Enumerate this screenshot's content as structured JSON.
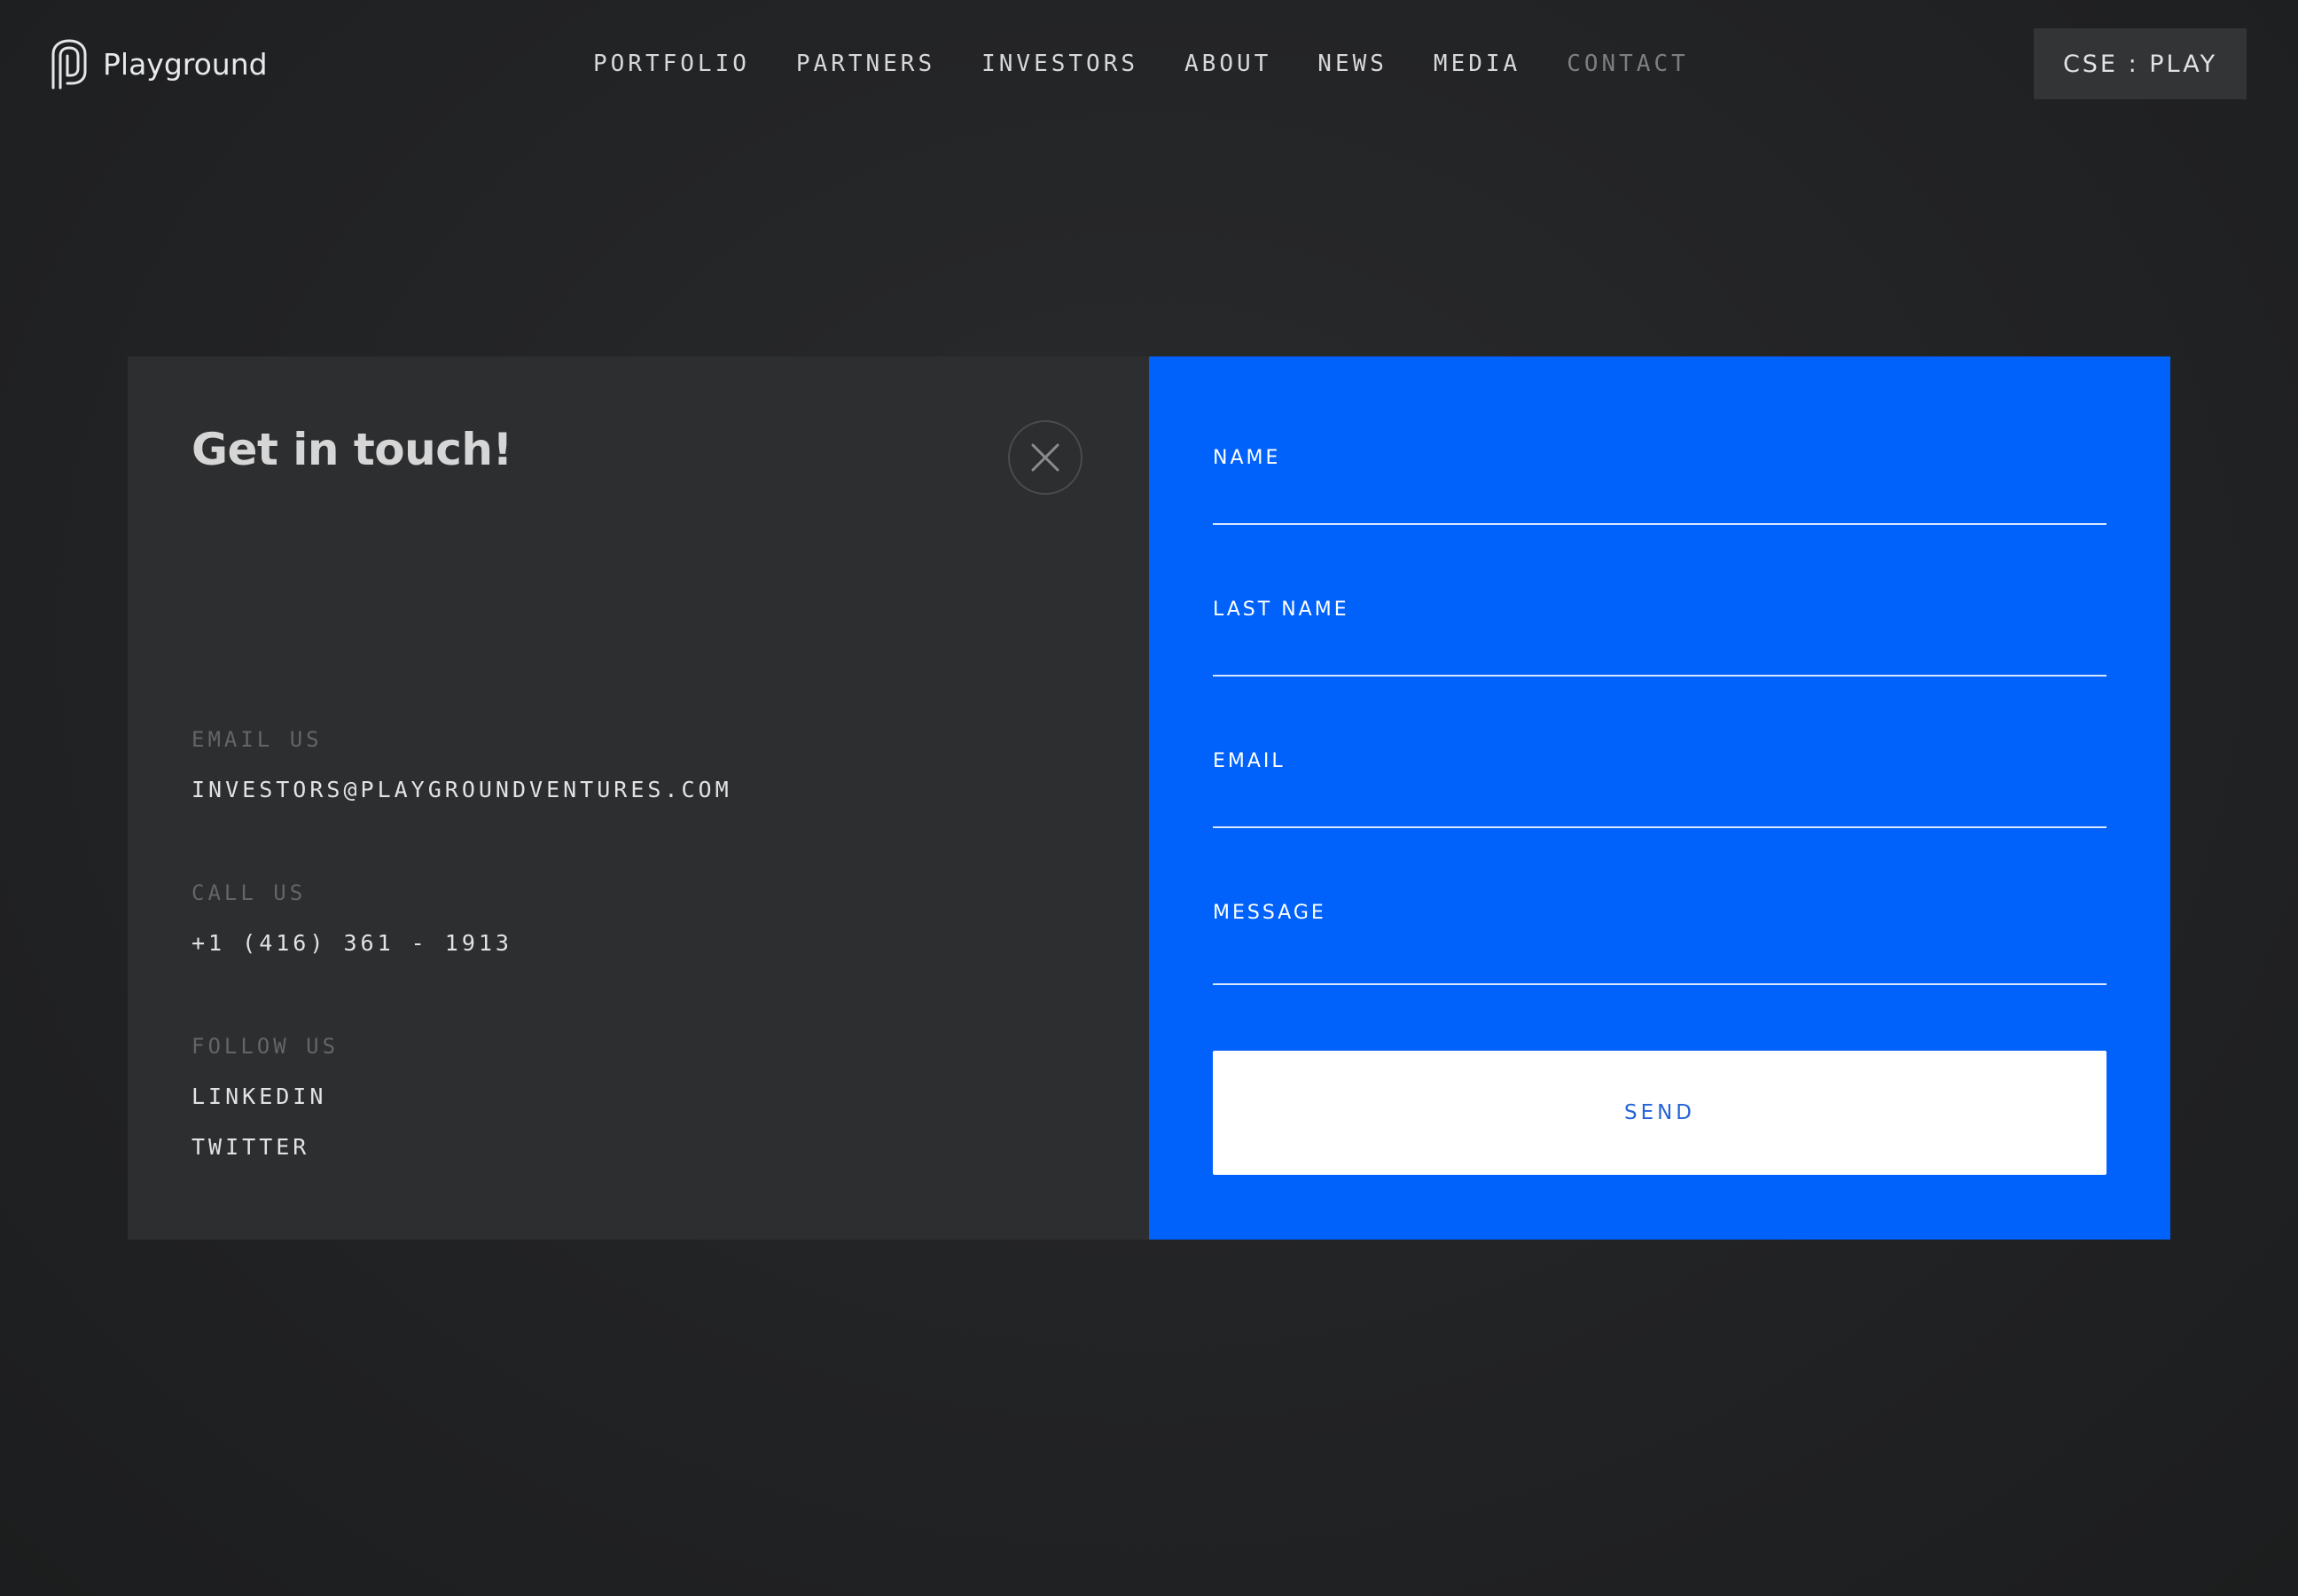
{
  "brand": {
    "name": "Playground",
    "logo_icon": "playground-p-icon"
  },
  "nav": {
    "items": [
      {
        "label": "PORTFOLIO",
        "active": false
      },
      {
        "label": "PARTNERS",
        "active": false
      },
      {
        "label": "INVESTORS",
        "active": false
      },
      {
        "label": "ABOUT",
        "active": false
      },
      {
        "label": "NEWS",
        "active": false
      },
      {
        "label": "MEDIA",
        "active": false
      },
      {
        "label": "CONTACT",
        "active": true
      }
    ]
  },
  "ticker": {
    "label": "CSE : PLAY"
  },
  "contact": {
    "title": "Get in touch!",
    "close_icon": "close-icon",
    "email": {
      "label": "EMAIL US",
      "value": "INVESTORS@PLAYGROUNDVENTURES.COM"
    },
    "call": {
      "label": "CALL US",
      "value": "+1 (416) 361 - 1913"
    },
    "follow": {
      "label": "FOLLOW US",
      "links": [
        "LINKEDIN",
        "TWITTER"
      ]
    }
  },
  "form": {
    "fields": [
      {
        "label": "NAME",
        "value": ""
      },
      {
        "label": "LAST NAME",
        "value": ""
      },
      {
        "label": "EMAIL",
        "value": ""
      },
      {
        "label": "MESSAGE",
        "value": ""
      }
    ],
    "submit_label": "SEND"
  },
  "colors": {
    "background": "#222325",
    "panel_dark": "#2d2e30",
    "accent_blue": "#0062fb",
    "nav_active": "#7d7e80",
    "send_text": "#2563d8"
  }
}
